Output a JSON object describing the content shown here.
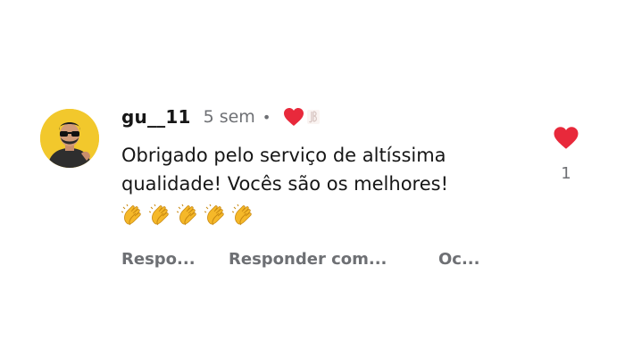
{
  "comment": {
    "username": "gu__11",
    "time_ago": "5 sem",
    "separator": "•",
    "text": "Obrigado pelo serviço de altíssima qualidade! Vocês são os melhores!",
    "emoji_icons": [
      "clapping-hands-icon",
      "clapping-hands-icon",
      "clapping-hands-icon",
      "clapping-hands-icon",
      "clapping-hands-icon"
    ],
    "liked_by_creator_icon": "heart-icon",
    "creator_mark_icon": "creator-avatar-icon"
  },
  "actions": {
    "reply_label": "Respo...",
    "reply_creator_label": "Responder com...",
    "hide_label": "Oc..."
  },
  "like": {
    "icon": "heart-icon",
    "count": "1",
    "liked": true
  },
  "colors": {
    "heart": "#e8293b",
    "muted_text": "#6e7074",
    "avatar_bg": "#f2c82c",
    "clap": "#f5b829"
  }
}
